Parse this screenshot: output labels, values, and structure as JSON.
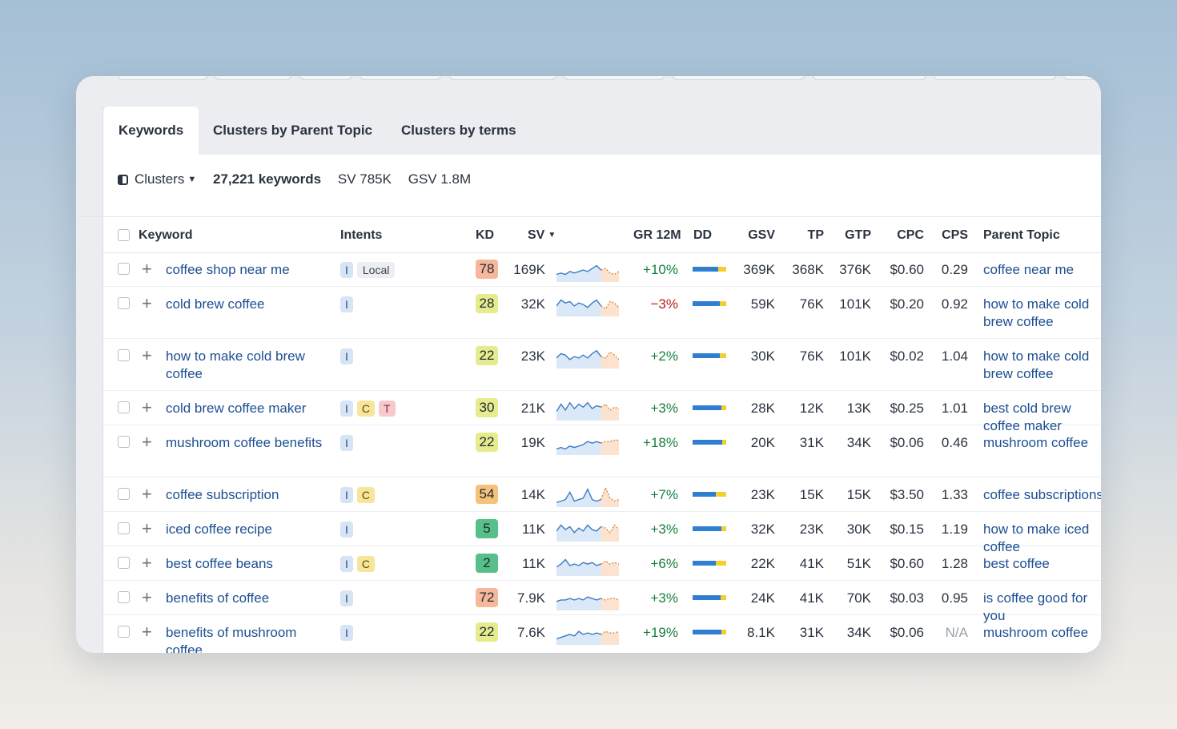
{
  "tabs": [
    {
      "label": "Keywords",
      "active": true
    },
    {
      "label": "Clusters by Parent Topic",
      "active": false
    },
    {
      "label": "Clusters by terms",
      "active": false
    }
  ],
  "summary": {
    "clusters_label": "Clusters",
    "keywords_count": "27,221 keywords",
    "sv": "SV 785K",
    "gsv": "GSV 1.8M"
  },
  "columns": {
    "keyword": "Keyword",
    "intents": "Intents",
    "kd": "KD",
    "sv": "SV",
    "gr12m": "GR 12M",
    "dd": "DD",
    "gsv": "GSV",
    "tp": "TP",
    "gtp": "GTP",
    "cpc": "CPC",
    "cps": "CPS",
    "parent_topic": "Parent Topic"
  },
  "colors": {
    "kd_red": "#f6b79a",
    "kd_yellow": "#e6eb8e",
    "kd_green": "#57c08a",
    "kd_orange": "#f6c27a",
    "link": "#1d4f91",
    "positive": "#15803d",
    "negative": "#b91c1c"
  },
  "rows": [
    {
      "keyword": "coffee shop near me",
      "intents": [
        "I",
        "Local"
      ],
      "kd": "78",
      "kd_color": "#f6b79a",
      "sv": "169K",
      "gr": "+10%",
      "dir": "up",
      "dd_fraction": 0.75,
      "gsv": "369K",
      "tp": "368K",
      "gtp": "376K",
      "cpc": "$0.60",
      "cps": "0.29",
      "parent_topic": "coffee near me",
      "spark": [
        8,
        9,
        8,
        10,
        9,
        10,
        11,
        10,
        12,
        14,
        11,
        12,
        9,
        8,
        10
      ]
    },
    {
      "keyword": "cold brew coffee",
      "intents": [
        "I"
      ],
      "kd": "28",
      "kd_color": "#e6eb8e",
      "sv": "32K",
      "gr": "−3%",
      "dir": "down",
      "dd_fraction": 0.8,
      "gsv": "59K",
      "tp": "76K",
      "gtp": "101K",
      "cpc": "$0.20",
      "cps": "0.92",
      "parent_topic": "how to make cold brew coffee",
      "spark": [
        10,
        14,
        12,
        13,
        10,
        12,
        11,
        9,
        12,
        14,
        10,
        8,
        13,
        12,
        9
      ]
    },
    {
      "keyword": "how to make cold brew coffee",
      "intents": [
        "I"
      ],
      "kd": "22",
      "kd_color": "#e6eb8e",
      "sv": "23K",
      "gr": "+2%",
      "dir": "up",
      "dd_fraction": 0.82,
      "gsv": "30K",
      "tp": "76K",
      "gtp": "101K",
      "cpc": "$0.02",
      "cps": "1.04",
      "parent_topic": "how to make cold brew coffee",
      "spark": [
        10,
        13,
        12,
        9,
        11,
        10,
        12,
        10,
        13,
        15,
        11,
        10,
        14,
        12,
        9
      ]
    },
    {
      "keyword": "cold brew coffee maker",
      "intents": [
        "I",
        "C",
        "T"
      ],
      "kd": "30",
      "kd_color": "#e6eb8e",
      "sv": "21K",
      "gr": "+3%",
      "dir": "up",
      "dd_fraction": 0.85,
      "gsv": "28K",
      "tp": "12K",
      "gtp": "13K",
      "cpc": "$0.25",
      "cps": "1.01",
      "parent_topic": "best cold brew coffee maker",
      "spark": [
        9,
        14,
        10,
        15,
        11,
        14,
        12,
        15,
        11,
        13,
        12,
        14,
        10,
        12,
        11
      ]
    },
    {
      "keyword": "mushroom coffee benefits",
      "intents": [
        "I"
      ],
      "kd": "22",
      "kd_color": "#e6eb8e",
      "sv": "19K",
      "gr": "+18%",
      "dir": "up",
      "dd_fraction": 0.88,
      "gsv": "20K",
      "tp": "31K",
      "gtp": "34K",
      "cpc": "$0.06",
      "cps": "0.46",
      "parent_topic": "mushroom coffee",
      "spark": [
        7,
        8,
        7,
        9,
        8,
        9,
        10,
        12,
        11,
        12,
        11,
        12,
        12,
        13,
        13
      ]
    },
    {
      "keyword": "coffee subscription",
      "intents": [
        "I",
        "C"
      ],
      "kd": "54",
      "kd_color": "#f6c27a",
      "sv": "14K",
      "gr": "+7%",
      "dir": "up",
      "dd_fraction": 0.68,
      "gsv": "23K",
      "tp": "15K",
      "gtp": "15K",
      "cpc": "$3.50",
      "cps": "1.33",
      "parent_topic": "coffee subscriptions",
      "spark": [
        6,
        7,
        8,
        13,
        7,
        8,
        9,
        15,
        8,
        7,
        8,
        16,
        9,
        7,
        8
      ]
    },
    {
      "keyword": "iced coffee recipe",
      "intents": [
        "I"
      ],
      "kd": "5",
      "kd_color": "#57c08a",
      "sv": "11K",
      "gr": "+3%",
      "dir": "up",
      "dd_fraction": 0.85,
      "gsv": "32K",
      "tp": "23K",
      "gtp": "30K",
      "cpc": "$0.15",
      "cps": "1.19",
      "parent_topic": "how to make iced coffee",
      "spark": [
        10,
        14,
        11,
        13,
        9,
        12,
        10,
        14,
        11,
        10,
        13,
        12,
        9,
        14,
        11
      ]
    },
    {
      "keyword": "best coffee beans",
      "intents": [
        "I",
        "C"
      ],
      "kd": "2",
      "kd_color": "#57c08a",
      "sv": "11K",
      "gr": "+6%",
      "dir": "up",
      "dd_fraction": 0.7,
      "gsv": "22K",
      "tp": "41K",
      "gtp": "51K",
      "cpc": "$0.60",
      "cps": "1.28",
      "parent_topic": "best coffee",
      "spark": [
        9,
        11,
        14,
        10,
        11,
        10,
        12,
        11,
        12,
        10,
        11,
        13,
        11,
        12,
        11
      ]
    },
    {
      "keyword": "benefits of coffee",
      "intents": [
        "I"
      ],
      "kd": "72",
      "kd_color": "#f6b79a",
      "sv": "7.9K",
      "gr": "+3%",
      "dir": "up",
      "dd_fraction": 0.84,
      "gsv": "24K",
      "tp": "41K",
      "gtp": "70K",
      "cpc": "$0.03",
      "cps": "0.95",
      "parent_topic": "is coffee good for you",
      "spark": [
        9,
        10,
        10,
        11,
        10,
        11,
        10,
        12,
        11,
        10,
        11,
        10,
        11,
        11,
        10
      ]
    },
    {
      "keyword": "benefits of mushroom coffee",
      "intents": [
        "I"
      ],
      "kd": "22",
      "kd_color": "#e6eb8e",
      "sv": "7.6K",
      "gr": "+19%",
      "dir": "up",
      "dd_fraction": 0.86,
      "gsv": "8.1K",
      "tp": "31K",
      "gtp": "34K",
      "cpc": "$0.06",
      "cps": "N/A",
      "parent_topic": "mushroom coffee",
      "spark": [
        7,
        8,
        9,
        10,
        9,
        12,
        10,
        11,
        10,
        11,
        10,
        12,
        11,
        11,
        12
      ]
    }
  ]
}
